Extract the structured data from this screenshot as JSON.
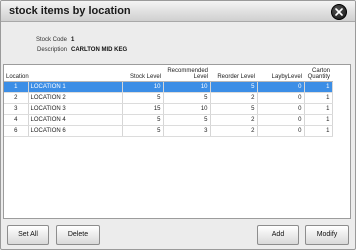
{
  "window": {
    "title": "stock items by location"
  },
  "info": {
    "stock_code_label": "Stock Code",
    "stock_code_value": "1",
    "description_label": "Description",
    "description_value": "CARLTON MID KEG"
  },
  "table": {
    "headers": {
      "location": "Location",
      "stock_level": "Stock Level",
      "recommended_level": "Recommended Level",
      "reorder_level": "Reorder Level",
      "layby_level": "LaybyLevel",
      "carton_quantity": "Carton Quantity"
    },
    "rows": [
      {
        "no": "1",
        "name": "LOCATION 1",
        "stock": "10",
        "recommended": "10",
        "reorder": "5",
        "layby": "0",
        "carton": "1",
        "selected": true
      },
      {
        "no": "2",
        "name": "LOCATION 2",
        "stock": "5",
        "recommended": "5",
        "reorder": "2",
        "layby": "0",
        "carton": "1",
        "selected": false
      },
      {
        "no": "3",
        "name": "LOCATION 3",
        "stock": "15",
        "recommended": "10",
        "reorder": "5",
        "layby": "0",
        "carton": "1",
        "selected": false
      },
      {
        "no": "4",
        "name": "LOCATION 4",
        "stock": "5",
        "recommended": "5",
        "reorder": "2",
        "layby": "0",
        "carton": "1",
        "selected": false
      },
      {
        "no": "6",
        "name": "LOCATION 6",
        "stock": "5",
        "recommended": "3",
        "reorder": "2",
        "layby": "0",
        "carton": "1",
        "selected": false
      }
    ]
  },
  "buttons": {
    "set_all": "Set All",
    "delete": "Delete",
    "add": "Add",
    "modify": "Modify"
  },
  "colors": {
    "selected_row": "#3c8ee6"
  },
  "icons": {
    "close": "close-icon"
  }
}
